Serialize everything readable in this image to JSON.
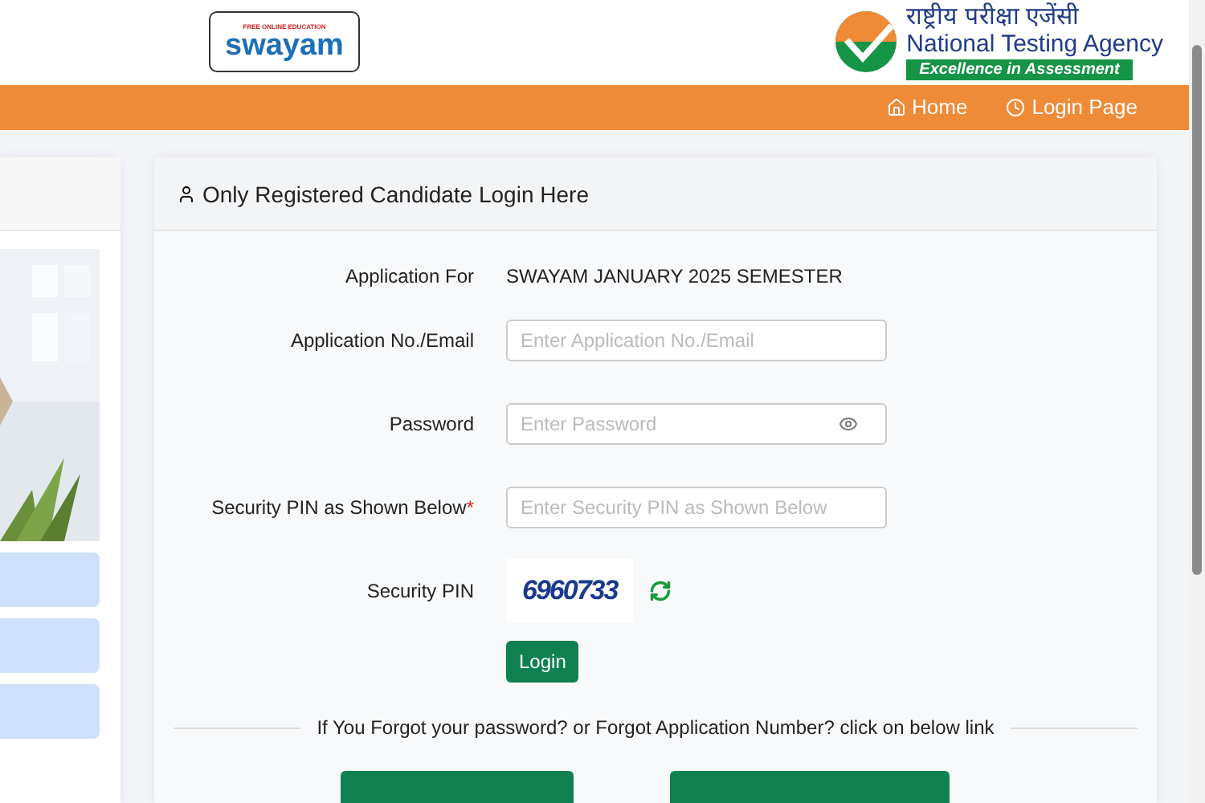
{
  "header": {
    "swayam_logo": {
      "tagline": "FREE ONLINE EDUCATION",
      "name": "swayam"
    },
    "nta_logo": {
      "hindi": "राष्ट्रीय परीक्षा एजेंसी",
      "name": "National Testing Agency",
      "slogan": "Excellence in Assessment"
    }
  },
  "nav": [
    {
      "label": "Home"
    },
    {
      "label": "Login Page"
    }
  ],
  "login_panel": {
    "title": "Only Registered Candidate Login Here",
    "fields": [
      {
        "kind": "text",
        "label": "Application For",
        "value": "SWAYAM JANUARY 2025 SEMESTER"
      },
      {
        "kind": "input",
        "label": "Application No./Email",
        "placeholder": "Enter Application No./Email"
      },
      {
        "kind": "password",
        "label": "Password",
        "placeholder": "Enter Password"
      },
      {
        "kind": "input",
        "label": "Security PIN as Shown Below",
        "required_mark": "*",
        "placeholder": "Enter Security PIN as Shown Below"
      },
      {
        "kind": "captcha",
        "label": "Security PIN",
        "value": "6960733"
      }
    ],
    "login_button": "Login",
    "forgot_note": "If You Forgot your password? or Forgot Application Number? click on below link"
  }
}
